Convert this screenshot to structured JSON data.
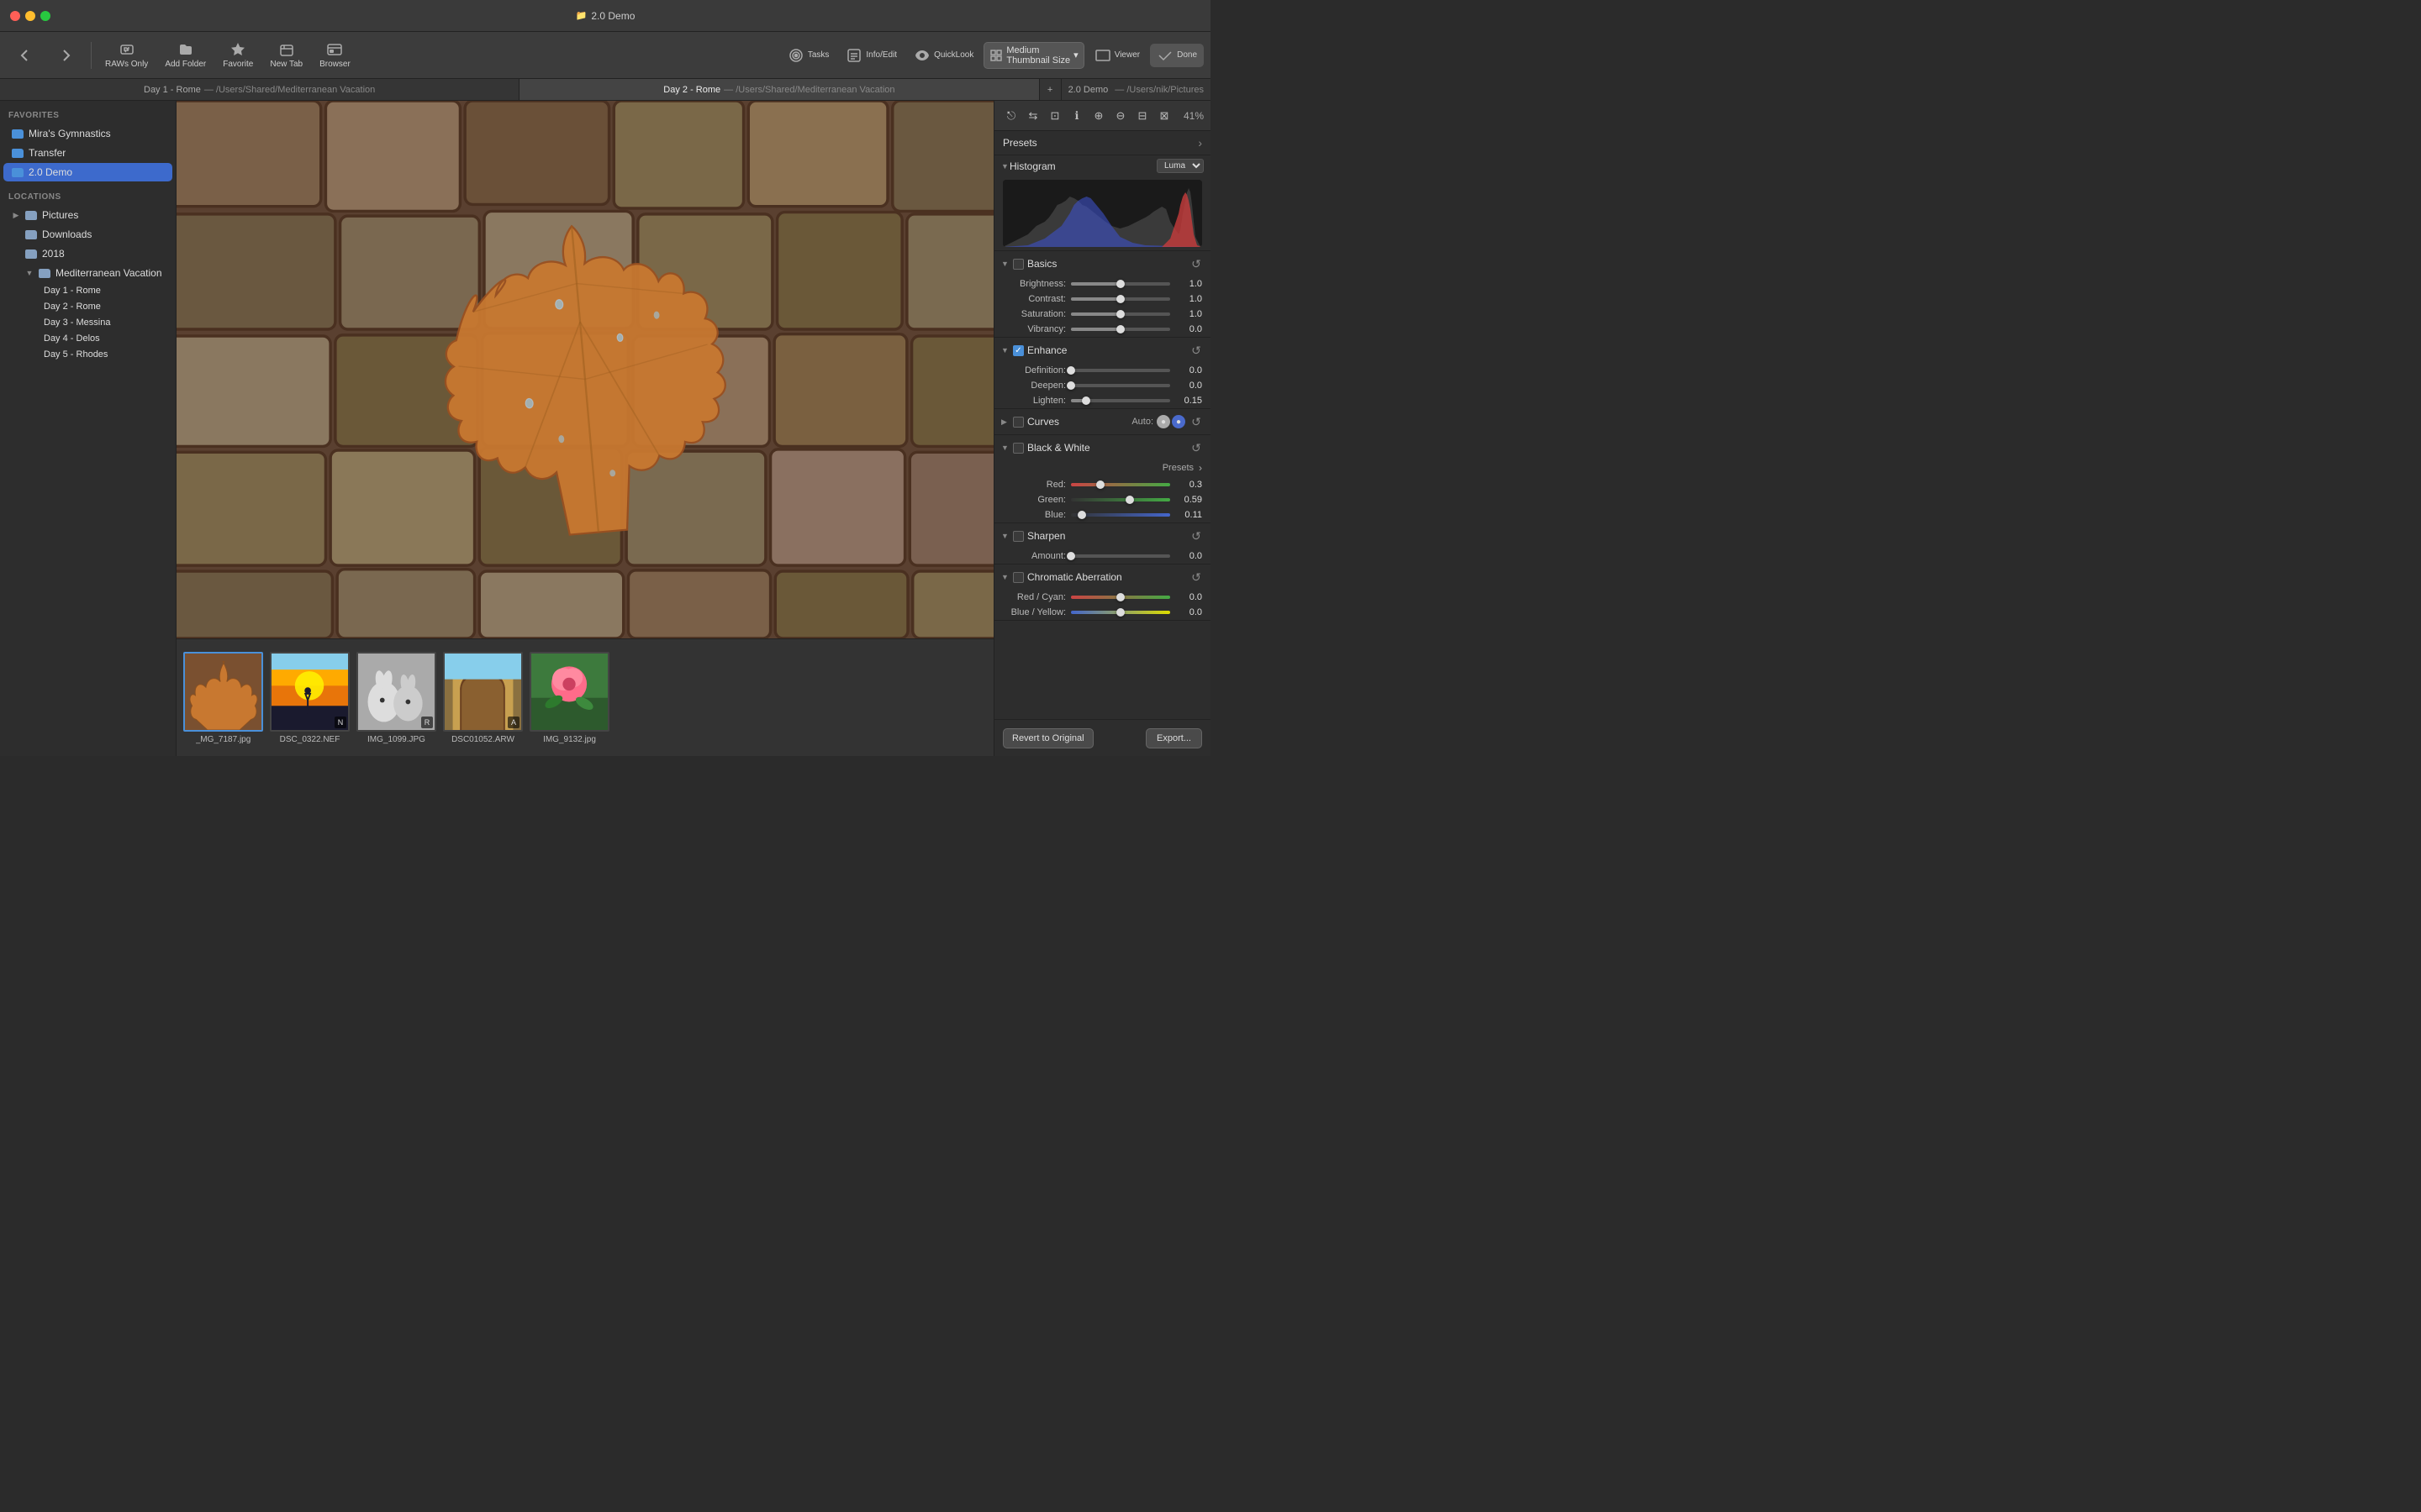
{
  "window": {
    "title": "2.0 Demo",
    "title_icon": "📁"
  },
  "toolbar": {
    "back_label": "",
    "forward_label": "",
    "raws_only_label": "RAWs Only",
    "add_folder_label": "Add Folder",
    "favorite_label": "Favorite",
    "new_tab_label": "New Tab",
    "browser_label": "Browser",
    "tasks_label": "Tasks",
    "info_edit_label": "Info/Edit",
    "quicklook_label": "QuickLook",
    "thumbnail_size_label": "Medium\nThumbnail Size",
    "viewer_label": "Viewer",
    "done_label": "Done",
    "zoom_level": "41%"
  },
  "tabs": [
    {
      "label": "Day 1 - Rome",
      "path": "— /Users/Shared/Mediterranean Vacation",
      "active": false
    },
    {
      "label": "Day 2 - Rome",
      "path": "— /Users/Shared/Mediterranean Vacation",
      "active": true
    },
    {
      "label": "2.0 Demo",
      "path": "— /Users/nik/Pictures",
      "extra": true
    }
  ],
  "sidebar": {
    "favorites_label": "FAVORITES",
    "locations_label": "LOCATIONS",
    "favorites": [
      {
        "label": "Mira's Gymnastics",
        "color": "blue"
      },
      {
        "label": "Transfer",
        "color": "blue"
      },
      {
        "label": "2.0 Demo",
        "color": "blue",
        "selected": true
      }
    ],
    "locations": [
      {
        "label": "Pictures",
        "color": "light",
        "indent": 0,
        "expand": true
      },
      {
        "label": "Downloads",
        "color": "light",
        "indent": 1,
        "expand": false
      },
      {
        "label": "2018",
        "color": "light",
        "indent": 1
      },
      {
        "label": "Mediterranean Vacation",
        "color": "light",
        "indent": 1,
        "expand": true
      },
      {
        "label": "Day 1 - Rome",
        "color": "light",
        "indent": 2
      },
      {
        "label": "Day 2 - Rome",
        "color": "light",
        "indent": 2
      },
      {
        "label": "Day 3 - Messina",
        "color": "light",
        "indent": 2
      },
      {
        "label": "Day 4 - Delos",
        "color": "light",
        "indent": 2
      },
      {
        "label": "Day 5 - Rhodes",
        "color": "light",
        "indent": 2
      }
    ]
  },
  "panel": {
    "presets_label": "Presets",
    "histogram_label": "Histogram",
    "histogram_mode": "Luma",
    "sections": [
      {
        "id": "basics",
        "label": "Basics",
        "expanded": true,
        "enabled": false,
        "sliders": [
          {
            "label": "Brightness:",
            "value": 1.0,
            "position": 0.5
          },
          {
            "label": "Contrast:",
            "value": 1.0,
            "position": 0.5
          },
          {
            "label": "Saturation:",
            "value": 1.0,
            "position": 0.5
          },
          {
            "label": "Vibrancy:",
            "value": 0.0,
            "position": 0.5
          }
        ]
      },
      {
        "id": "enhance",
        "label": "Enhance",
        "expanded": true,
        "enabled": true,
        "sliders": [
          {
            "label": "Definition:",
            "value": 0.0,
            "position": 0.0
          },
          {
            "label": "Deepen:",
            "value": 0.0,
            "position": 0.0
          },
          {
            "label": "Lighten:",
            "value": 0.15,
            "position": 0.15
          }
        ]
      },
      {
        "id": "curves",
        "label": "Curves",
        "expanded": false,
        "enabled": false,
        "auto_label": "Auto:"
      },
      {
        "id": "black_white",
        "label": "Black & White",
        "expanded": true,
        "enabled": false,
        "presets_label": "Presets",
        "sliders": [
          {
            "label": "Red:",
            "value": 0.3,
            "position": 0.3
          },
          {
            "label": "Green:",
            "value": 0.59,
            "position": 0.59
          },
          {
            "label": "Blue:",
            "value": 0.11,
            "position": 0.11
          }
        ]
      },
      {
        "id": "sharpen",
        "label": "Sharpen",
        "expanded": true,
        "enabled": false,
        "sliders": [
          {
            "label": "Amount:",
            "value": 0.0,
            "position": 0.0
          }
        ]
      },
      {
        "id": "chromatic_aberration",
        "label": "Chromatic Aberration",
        "expanded": true,
        "enabled": false,
        "sliders": [
          {
            "label": "Red / Cyan:",
            "value": 0.0,
            "position": 0.5
          },
          {
            "label": "Blue / Yellow:",
            "value": 0.0,
            "position": 0.5
          }
        ]
      }
    ]
  },
  "filmstrip": {
    "items": [
      {
        "filename": "_MG_7187.jpg",
        "selected": true,
        "type": "leaf"
      },
      {
        "filename": "DSC_0322.NEF",
        "selected": false,
        "type": "sunset",
        "badge": "N"
      },
      {
        "filename": "IMG_1099.JPG",
        "selected": false,
        "type": "rabbits",
        "badge": "R"
      },
      {
        "filename": "DSC01052.ARW",
        "selected": false,
        "type": "arch",
        "badge": "A"
      },
      {
        "filename": "IMG_9132.jpg",
        "selected": false,
        "type": "flower"
      }
    ]
  },
  "bottom_panel": {
    "revert_label": "Revert to Original",
    "export_label": "Export..."
  }
}
